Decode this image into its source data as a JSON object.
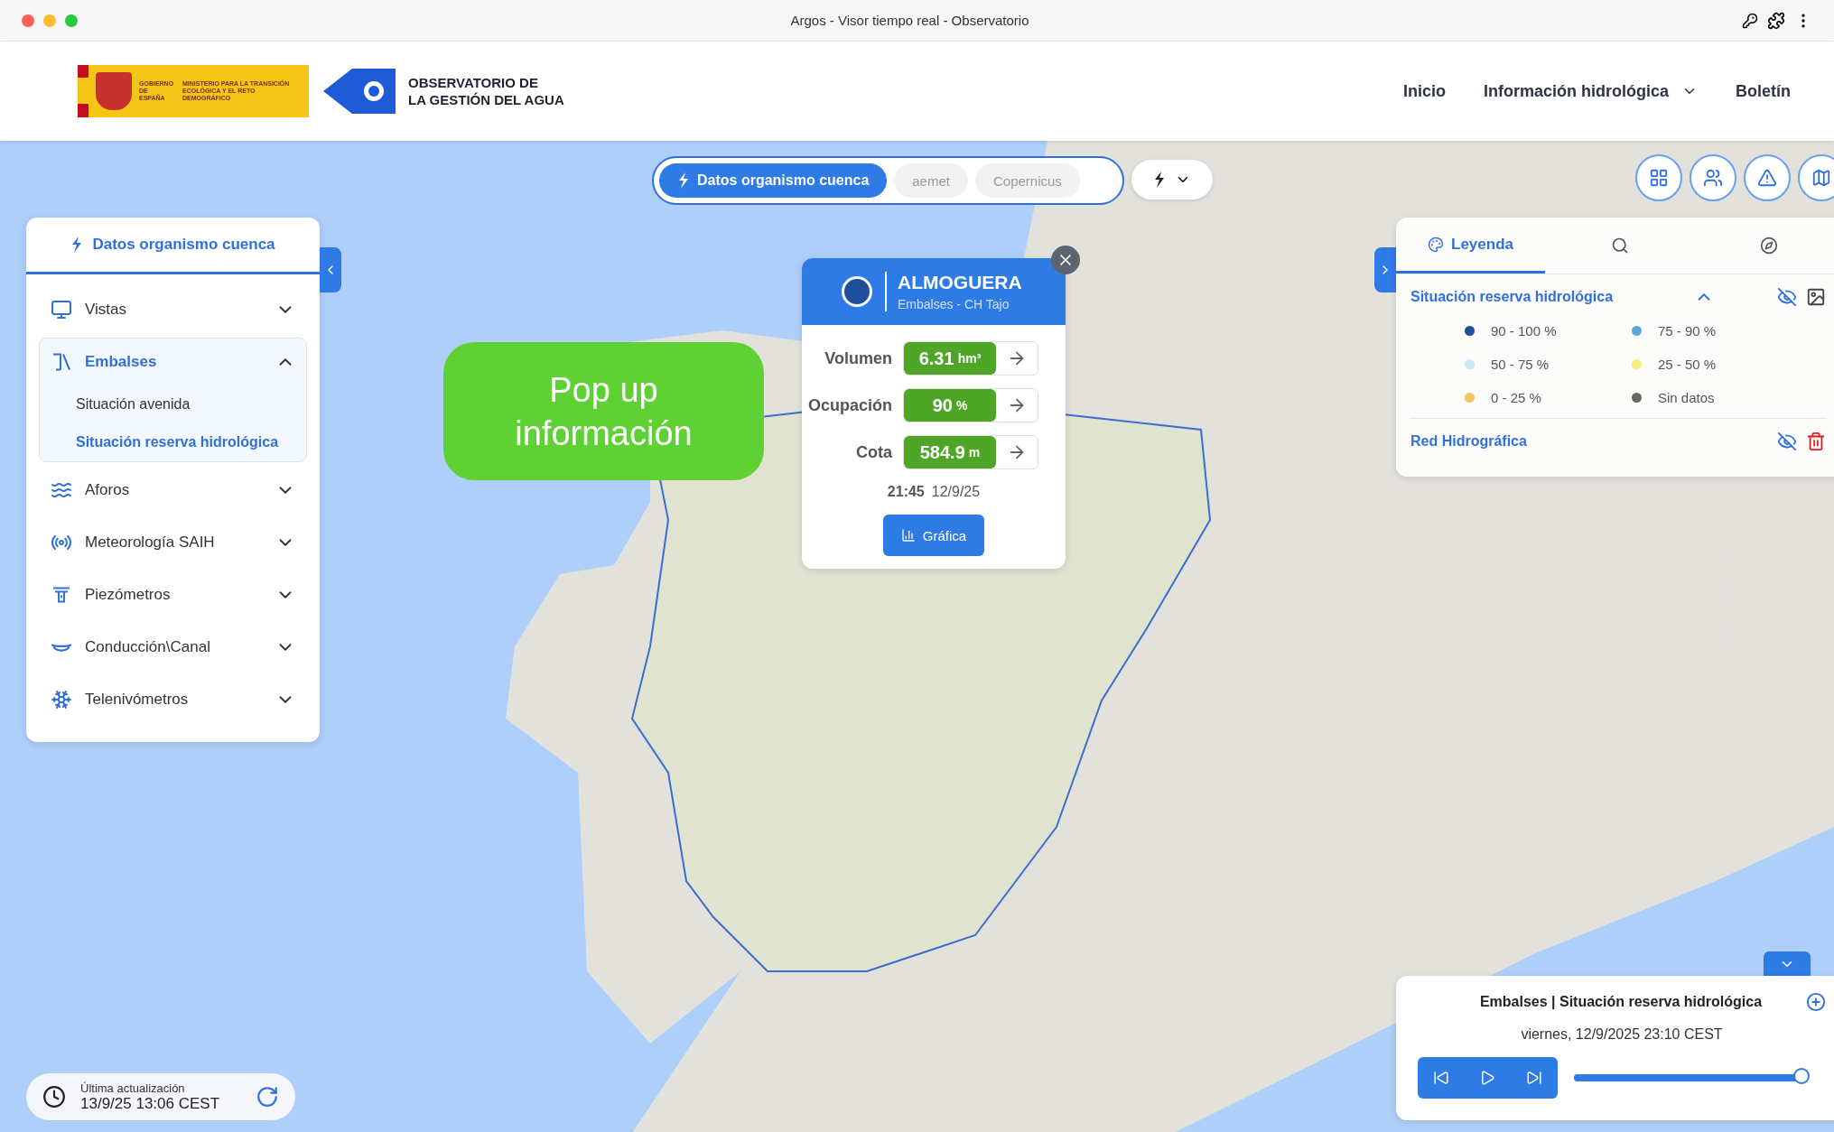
{
  "window": {
    "title": "Argos - Visor tiempo real - Observatorio"
  },
  "header": {
    "gov_logo": {
      "line_1": "GOBIERNO DE ESPAÑA",
      "line_2": "MINISTERIO PARA LA TRANSICIÓN ECOLÓGICA Y EL RETO DEMOGRÁFICO"
    },
    "brand": [
      "OBSERVATORIO DE",
      "LA GESTIÓN DEL AGUA"
    ],
    "nav": [
      {
        "label": "Inicio",
        "dropdown": false
      },
      {
        "label": "Información hidrológica",
        "dropdown": true
      },
      {
        "label": "Boletín",
        "dropdown": false
      }
    ]
  },
  "source_toggle": [
    {
      "label": "Datos organismo cuenca",
      "selected": true
    },
    {
      "label": "aemet",
      "selected": false
    },
    {
      "label": "Copernicus",
      "selected": false
    }
  ],
  "sidebar": {
    "tab": "Datos organismo cuenca",
    "items": [
      {
        "label": "Vistas",
        "expanded": false
      },
      {
        "label": "Embalses",
        "expanded": true,
        "children": [
          {
            "label": "Situación avenida",
            "selected": false
          },
          {
            "label": "Situación reserva hidrológica",
            "selected": true
          }
        ]
      },
      {
        "label": "Aforos",
        "expanded": false
      },
      {
        "label": "Meteorología SAIH",
        "expanded": false
      },
      {
        "label": "Piezómetros",
        "expanded": false
      },
      {
        "label": "Conducción\\Canal",
        "expanded": false
      },
      {
        "label": "Telenivómetros",
        "expanded": false
      }
    ]
  },
  "annotation": [
    "Pop up",
    "información"
  ],
  "popup": {
    "title": "ALMOGUERA",
    "subtitle": "Embalses - CH Tajo",
    "rows": [
      {
        "label": "Volumen",
        "value": "6.31",
        "unit": "hm³"
      },
      {
        "label": "Ocupación",
        "value": "90",
        "unit": "%"
      },
      {
        "label": "Cota",
        "value": "584.9",
        "unit": "m"
      }
    ],
    "time": "21:45",
    "date": "12/9/25",
    "button": "Gráfica"
  },
  "legend": {
    "tab": "Leyenda",
    "layers": [
      {
        "title": "Situación reserva hidrológica",
        "kind": "grouped",
        "expanded": true,
        "items": [
          {
            "label": "90 - 100 %",
            "color": "#1f4e9c"
          },
          {
            "label": "75 - 90 %",
            "color": "#5aa7e0"
          },
          {
            "label": "50 - 75 %",
            "color": "#c9eaf2"
          },
          {
            "label": "25 - 50 %",
            "color": "#f7ef7a"
          },
          {
            "label": "0 - 25 %",
            "color": "#f3c461"
          },
          {
            "label": "Sin datos",
            "color": "#6b6565"
          }
        ]
      },
      {
        "title": "Red Hidrográfica",
        "kind": "simple"
      }
    ]
  },
  "player": {
    "title": "Embalses | Situación reserva hidrológica",
    "date": "viernes, 12/9/2025 23:10 CEST",
    "level": 1
  },
  "status": {
    "label": "Última actualización",
    "value": "13/9/25 13:06 CEST"
  }
}
